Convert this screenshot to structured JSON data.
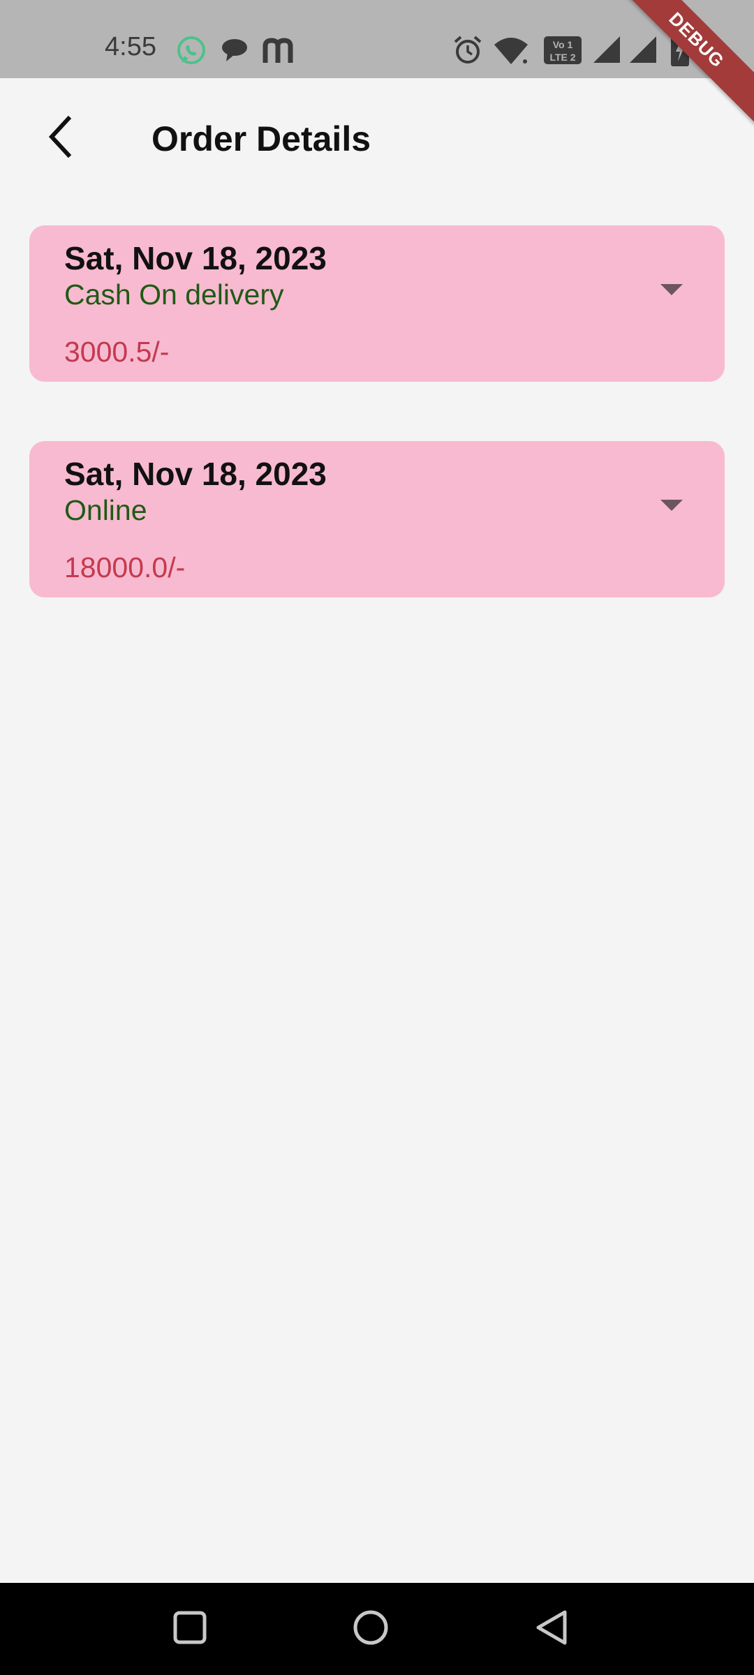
{
  "status_bar": {
    "time": "4:55",
    "icons": [
      "whatsapp-icon",
      "chat-bubble-icon",
      "m-app-icon",
      "alarm-icon",
      "wifi-icon",
      "volte-lte2-icon",
      "signal-icon",
      "signal-icon",
      "battery-charging-icon"
    ]
  },
  "debug_banner": "DEBUG",
  "app_bar": {
    "title": "Order Details",
    "back_icon": "back-chevron-icon"
  },
  "orders": [
    {
      "date": "Sat, Nov 18, 2023",
      "payment_method": "Cash On delivery",
      "amount": "3000.5/-"
    },
    {
      "date": "Sat, Nov 18, 2023",
      "payment_method": "Online",
      "amount": "18000.0/-"
    }
  ],
  "colors": {
    "card_background": "#f8bad0",
    "payment_method_text": "#1f5a16",
    "amount_text": "#c23a4f",
    "debug_banner": "#a33b3b"
  }
}
